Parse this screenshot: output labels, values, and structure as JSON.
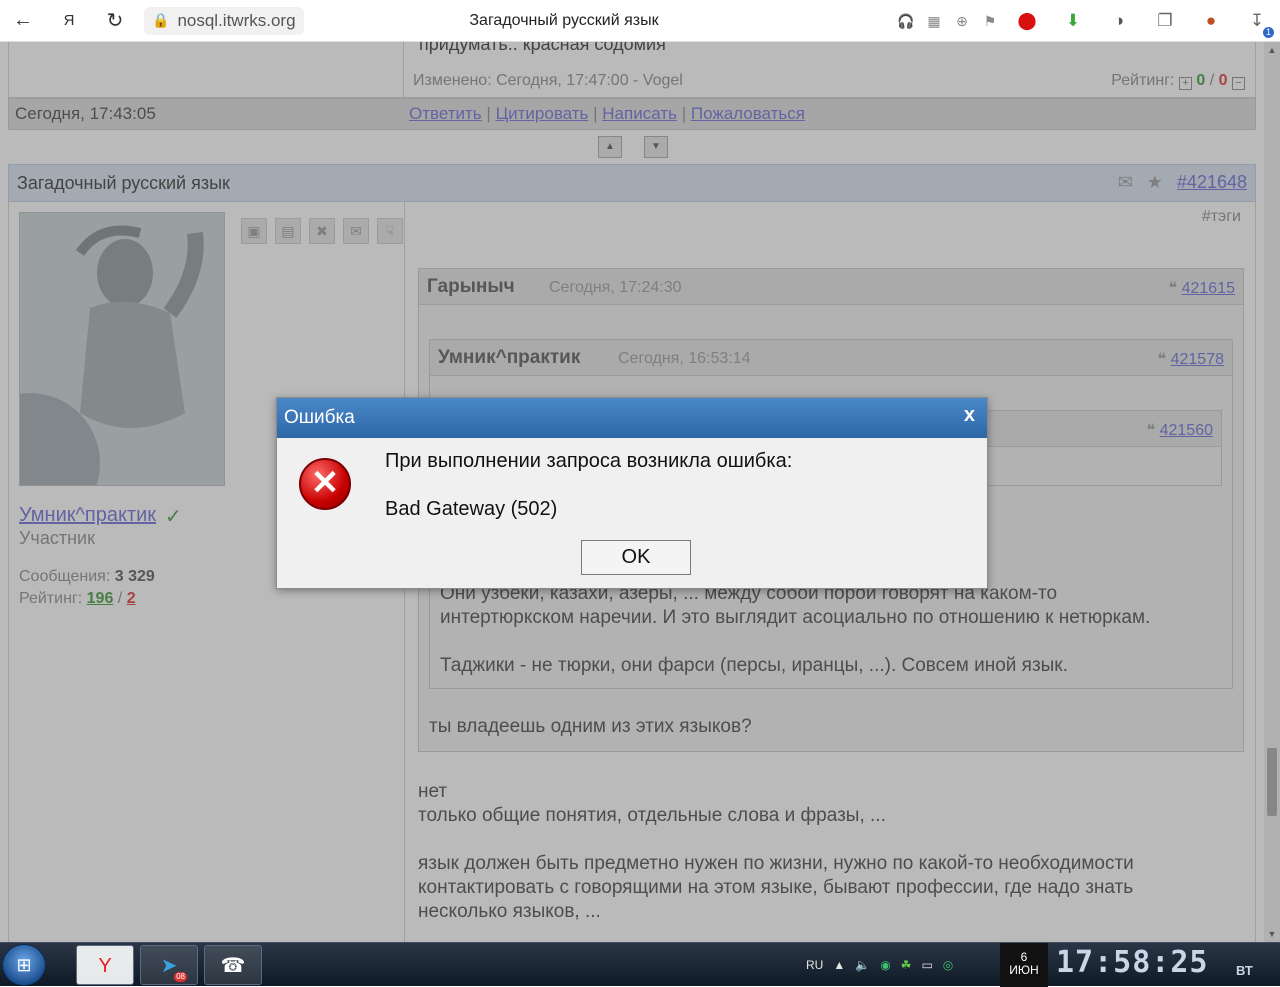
{
  "browser": {
    "url": "nosql.itwrks.org",
    "tab_title": "Загадочный русский язык",
    "download_badge": "1"
  },
  "prev_post": {
    "text_partial": "придумать.. красная содомия",
    "edited": "Изменено: Сегодня, 17:47:00 - Vogel",
    "rating_label": "Рейтинг:",
    "rating_up": "0",
    "rating_sep": "/",
    "rating_down": "0",
    "date": "Сегодня, 17:43:05",
    "links": [
      "Ответить",
      "Цитировать",
      "Написать",
      "Пожаловаться"
    ],
    "link_sep": "|"
  },
  "post": {
    "title": "Загадочный русский язык",
    "id": "#421648",
    "tags": "#тэги",
    "author": {
      "name": "Умник^практик",
      "role": "Участник",
      "messages_label": "Сообщения:",
      "messages": "3 329",
      "rating_label": "Рейтинг:",
      "rating_up": "196",
      "rating_sep": "/",
      "rating_down": "2"
    },
    "quote1": {
      "author": "Гарыныч",
      "time": "Сегодня, 17:24:30",
      "id": "421615"
    },
    "quote2": {
      "author": "Умник^практик",
      "time": "Сегодня, 16:53:14",
      "id": "421578"
    },
    "quote3": {
      "id": "421560"
    },
    "quote2_text": [
      "Они узбеки, казахи, азеры, ... между собой порой говорят на каком-то",
      "интертюркском наречии. И это выглядит асоциально по отношению к нетюркам.",
      "Таджики - не тюрки, они фарси (персы, иранцы, ...). Совсем иной язык."
    ],
    "quote1_text": "ты владеешь одним из этих языков?",
    "body": [
      "нет",
      "только общие понятия, отдельные слова и фразы, ...",
      "язык должен быть предметно нужен по жизни, нужно по какой-то необходимости",
      "контактировать с говорящими на этом языке, бывают профессии, где надо знать",
      "несколько языков, ..."
    ]
  },
  "dialog": {
    "title": "Ошибка",
    "close": "x",
    "message": "При выполнении запроса возникла ошибка:",
    "code": "Bad Gateway (502)",
    "ok": "OK"
  },
  "taskbar": {
    "lang": "RU",
    "telegram_badge": "08",
    "date_line1": "6",
    "date_line2": "ИЮН",
    "time": "17:58:25",
    "day": "ВТ"
  },
  "colors": {
    "accent": "#2e67a8",
    "link": "#6a6ad8",
    "positive": "#3a9a3a",
    "negative": "#dd3333"
  }
}
